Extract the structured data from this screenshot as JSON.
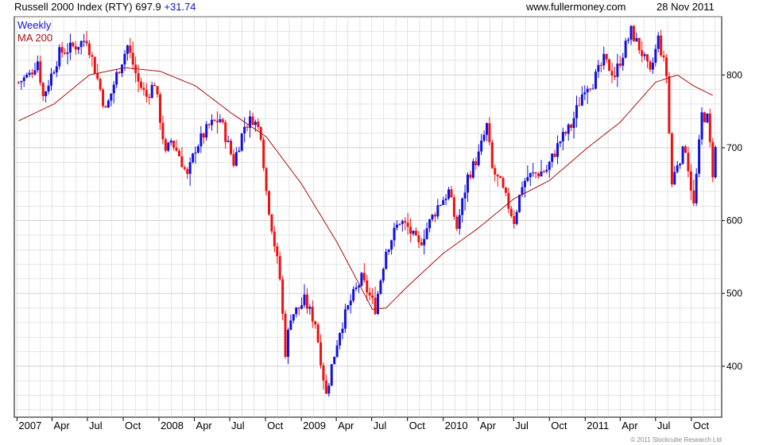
{
  "header": {
    "title": "Russell 2000 Index (RTY)",
    "last": "697.9",
    "change": "+31.74",
    "source": "www.fullermoney.com",
    "date": "28 Nov 2011"
  },
  "footer": "© 2011 Stockcube Research Ltd",
  "colors": {
    "up": "#1111dd",
    "down": "#ee1111",
    "ma": "#aa1111",
    "grid": "#cccccc",
    "change": "#1111cc"
  },
  "chart_data": {
    "type": "ohlc",
    "ylim": [
      330,
      880
    ],
    "y_ticks": [
      400,
      500,
      600,
      700,
      800
    ],
    "x_ticks": [
      "2007",
      "Apr",
      "Jul",
      "Oct",
      "2008",
      "Apr",
      "Jul",
      "Oct",
      "2009",
      "Apr",
      "Jul",
      "Oct",
      "2010",
      "Apr",
      "Jul",
      "Oct",
      "2011",
      "Apr",
      "Jul",
      "Oct"
    ],
    "grid": true,
    "legend": "top-left",
    "series": [
      {
        "name": "Weekly",
        "type": "weekly-bars",
        "anchors": [
          [
            "2007-01-05",
            790
          ],
          [
            "2007-02-02",
            800
          ],
          [
            "2007-02-23",
            820
          ],
          [
            "2007-03-09",
            770
          ],
          [
            "2007-04-20",
            830
          ],
          [
            "2007-06-01",
            840
          ],
          [
            "2007-06-29",
            850
          ],
          [
            "2007-08-03",
            780
          ],
          [
            "2007-08-17",
            750
          ],
          [
            "2007-09-14",
            800
          ],
          [
            "2007-10-12",
            840
          ],
          [
            "2007-11-09",
            790
          ],
          [
            "2007-11-30",
            770
          ],
          [
            "2007-12-21",
            790
          ],
          [
            "2008-01-18",
            690
          ],
          [
            "2008-02-01",
            710
          ],
          [
            "2008-02-22",
            690
          ],
          [
            "2008-03-14",
            660
          ],
          [
            "2008-04-04",
            700
          ],
          [
            "2008-05-09",
            730
          ],
          [
            "2008-06-06",
            740
          ],
          [
            "2008-07-11",
            680
          ],
          [
            "2008-08-08",
            730
          ],
          [
            "2008-08-29",
            740
          ],
          [
            "2008-09-19",
            720
          ],
          [
            "2008-10-03",
            640
          ],
          [
            "2008-10-24], 480"
          ],
          [
            "2008-11-07",
            520
          ],
          [
            "2008-11-21",
            420
          ],
          [
            "2008-12-05",
            470
          ],
          [
            "2008-12-26",
            480
          ],
          [
            "2009-01-09",
            490
          ],
          [
            "2009-02-06",
            460
          ],
          [
            "2009-03-06",
            360
          ],
          [
            "2009-03-20",
            400
          ],
          [
            "2009-04-10",
            450
          ],
          [
            "2009-05-08",
            490
          ],
          [
            "2009-06-05",
            520
          ],
          [
            "2009-07-10",
            480
          ],
          [
            "2009-08-07",
            560
          ],
          [
            "2009-09-11",
            600
          ],
          [
            "2009-10-02",
            590
          ],
          [
            "2009-10-30",
            565
          ],
          [
            "2009-11-20",
            590
          ],
          [
            "2009-12-18",
            620
          ],
          [
            "2010-01-15",
            640
          ],
          [
            "2010-02-05",
            590
          ],
          [
            "2010-03-05",
            660
          ],
          [
            "2010-04-02",
            690
          ],
          [
            "2010-04-23",
            730
          ],
          [
            "2010-05-07",
            670
          ],
          [
            "2010-05-28",
            650
          ],
          [
            "2010-07-02",
            600
          ],
          [
            "2010-07-23",
            650
          ],
          [
            "2010-08-06",
            660
          ],
          [
            "2010-08-27], 600"
          ],
          [
            "2010-09-24",
            670
          ],
          [
            "2010-10-29",
            710
          ],
          [
            "2010-11-26",
            730
          ],
          [
            "2010-12-31",
            785
          ],
          [
            "2011-01-21",
            790
          ],
          [
            "2011-02-18",
            820
          ],
          [
            "2011-03-18",
            800
          ],
          [
            "2011-04-29",
            860
          ],
          [
            "2011-05-27",
            830
          ],
          [
            "2011-06-17",
            800
          ],
          [
            "2011-07-08",
            850
          ],
          [
            "2011-07-29",
            800
          ],
          [
            "2011-08-05",
            720
          ],
          [
            "2011-08-12",
            650
          ],
          [
            "2011-08-26",
            680
          ],
          [
            "2011-09-16",
            700
          ],
          [
            "2011-10-07",
            620
          ],
          [
            "2011-10-28",
            745
          ],
          [
            "2011-11-11",
            740
          ],
          [
            "2011-11-25",
            666
          ],
          [
            "2011-12-02",
            698
          ]
        ]
      },
      {
        "name": "MA 200",
        "type": "line",
        "anchors": [
          [
            "2007-01-05",
            737
          ],
          [
            "2007-04-06",
            760
          ],
          [
            "2007-07-06",
            800
          ],
          [
            "2007-10-05",
            810
          ],
          [
            "2008-01-04",
            805
          ],
          [
            "2008-04-04",
            785
          ],
          [
            "2008-07-04",
            748
          ],
          [
            "2008-10-03",
            715
          ],
          [
            "2009-01-02",
            650
          ],
          [
            "2009-04-03",
            570
          ],
          [
            "2009-07-03",
            478
          ],
          [
            "2009-08-07",
            480
          ],
          [
            "2009-10-02",
            510
          ],
          [
            "2010-01-01",
            555
          ],
          [
            "2010-04-02",
            590
          ],
          [
            "2010-07-02",
            630
          ],
          [
            "2010-10-01",
            655
          ],
          [
            "2011-01-07",
            700
          ],
          [
            "2011-04-01",
            735
          ],
          [
            "2011-07-01",
            790
          ],
          [
            "2011-08-26",
            800
          ],
          [
            "2011-10-07",
            785
          ],
          [
            "2011-11-25",
            772
          ]
        ]
      }
    ]
  }
}
